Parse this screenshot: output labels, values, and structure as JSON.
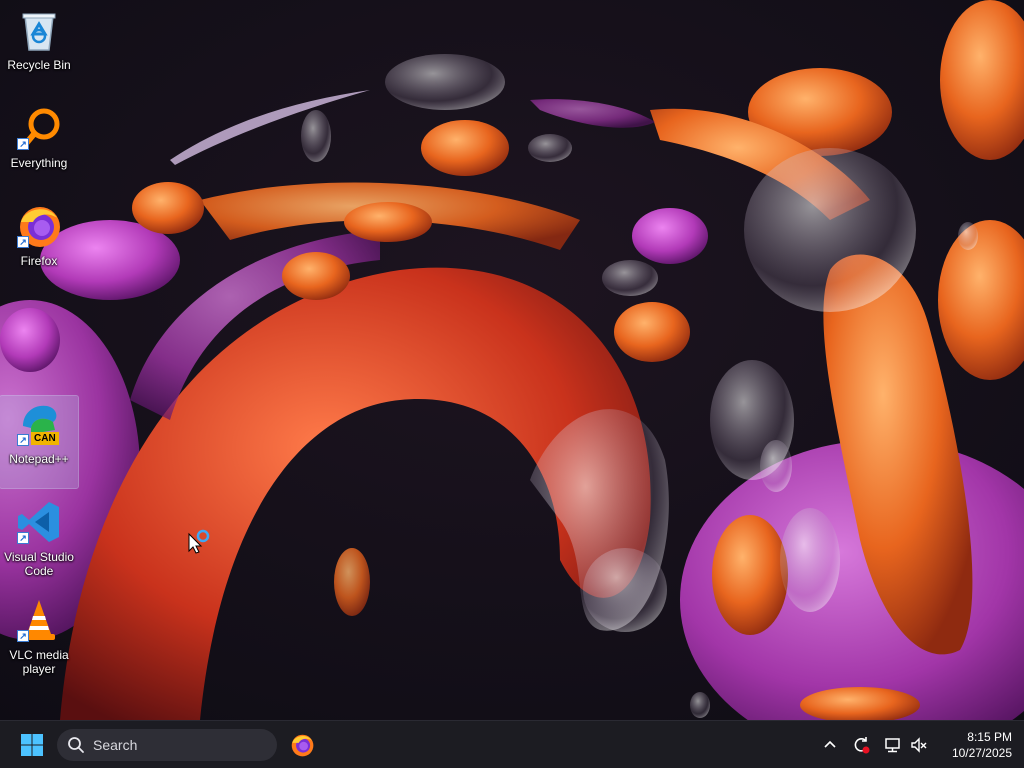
{
  "desktop": {
    "icons": [
      {
        "label": "Recycle Bin",
        "icon": "recycle-bin-icon"
      },
      {
        "label": "Everything",
        "icon": "everything-search-icon"
      },
      {
        "label": "Firefox",
        "icon": "firefox-icon"
      },
      {
        "label": "Notepad++",
        "icon": "notepad-plus-plus-icon",
        "overlay_text": "CAN",
        "selected": true
      },
      {
        "label": "Visual Studio Code",
        "icon": "vscode-icon"
      },
      {
        "label": "VLC media player",
        "icon": "vlc-icon"
      }
    ]
  },
  "taskbar": {
    "search_placeholder": "Search",
    "pinned": [
      {
        "name": "Firefox",
        "icon": "firefox-icon"
      }
    ],
    "tray_icons": [
      "chevron-up-icon",
      "sync-icon",
      "network-icon",
      "volume-muted-icon"
    ],
    "clock_time": "8:15 PM",
    "clock_date": "10/27/2025"
  },
  "colors": {
    "taskbar_bg": "#1c1c22",
    "accent_blue": "#3fa8f5",
    "wallpaper_orange": "#e8651e",
    "wallpaper_magenta": "#b23ab8"
  }
}
